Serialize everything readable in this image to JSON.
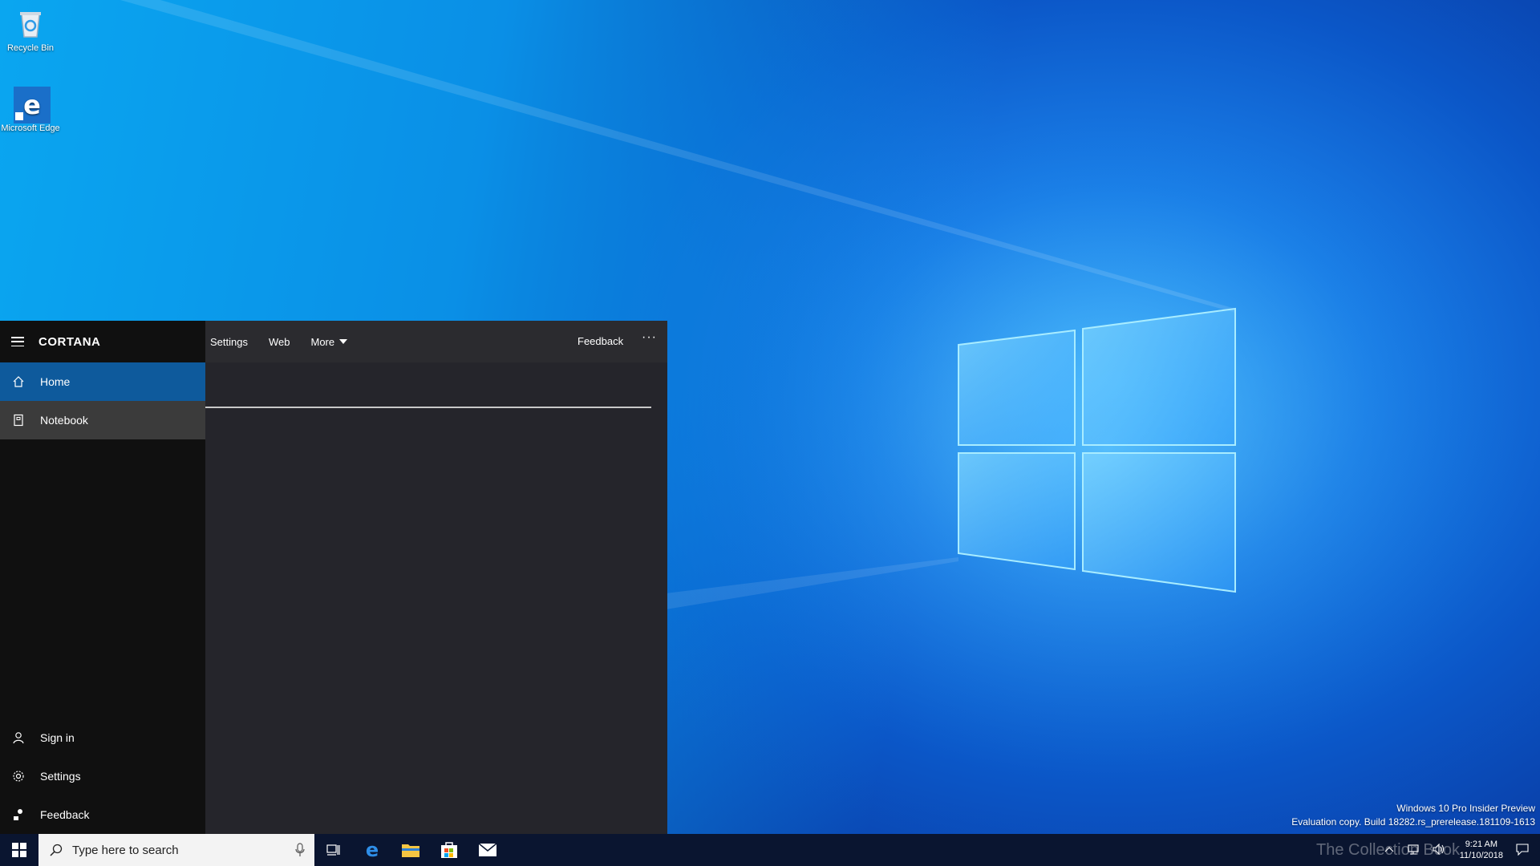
{
  "desktop": {
    "icons": [
      {
        "label": "Recycle Bin",
        "icon": "recycle-bin-icon"
      },
      {
        "label": "Microsoft Edge",
        "icon": "edge-icon"
      }
    ]
  },
  "cortana": {
    "title": "CORTANA",
    "nav": {
      "home": "Home",
      "notebook": "Notebook",
      "sign_in": "Sign in",
      "settings": "Settings",
      "feedback": "Feedback"
    },
    "tabs": [
      "Settings",
      "Web",
      "More"
    ],
    "feedback_label": "Feedback",
    "more_menu": "···",
    "colors": {
      "home_selected": "#0e5a9c",
      "sidebar": "#101010",
      "main": "#25252b"
    }
  },
  "taskbar": {
    "search_placeholder": "Type here to search",
    "time": "9:21 AM",
    "date": "11/10/2018",
    "background": "#0a1530"
  },
  "watermark": {
    "line1": "Windows 10 Pro Insider Preview",
    "line2": "Evaluation copy. Build 18282.rs_prerelease.181109-1613",
    "brand": "The Collection Book"
  }
}
